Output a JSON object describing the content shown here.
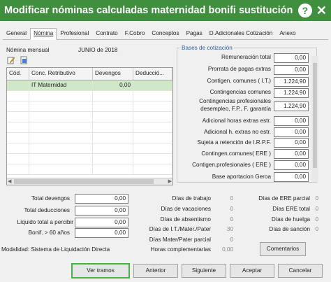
{
  "window": {
    "title": "Modificar nóminas calculadas maternidad bonifi sustitución"
  },
  "tabs": [
    "General",
    "Nómina",
    "Profesional",
    "Contrato",
    "F.Cobro",
    "Conceptos",
    "Pagas",
    "D.Adicionales Cotización",
    "Anexo"
  ],
  "nomina": {
    "label": "Nómina mensual",
    "period": "JUNIO de 2018"
  },
  "grid": {
    "headers": [
      "Cód.",
      "Conc. Retributivo",
      "Devengos",
      "Deducció..."
    ],
    "rows": [
      {
        "cod": "",
        "concepto": "IT Maternidad",
        "devengos": "0,00",
        "deducciones": ""
      }
    ]
  },
  "bases": {
    "title": "Bases de cotización",
    "fields": [
      {
        "label": "Remuneración total",
        "value": "0,00"
      },
      {
        "label": "Prorrata de pagas extras",
        "value": "0,00"
      },
      {
        "label": "Contigen. comunes ( I.T.)",
        "value": "1.224,90"
      },
      {
        "label": "Contingencias comunes",
        "value": "1.224,90"
      },
      {
        "label": "Contingencias profesionales",
        "label2": "desempleo, F.P., F. garantía",
        "value": "1.224,90"
      },
      {
        "label": "Adicional horas extras estr.",
        "value": "0,00"
      },
      {
        "label": "Adicional h. extras no estr.",
        "value": "0,00"
      },
      {
        "label": "Sujeta a retención de I.R.P.F.",
        "value": "0,00"
      },
      {
        "label": "Contingen.comunes( ERE )",
        "value": "0,00"
      },
      {
        "label": "Contigen.profesionales ( ERE )",
        "value": "0,00"
      },
      {
        "label": "Base aportacion Geroa",
        "value": "0,00"
      }
    ]
  },
  "totals": [
    {
      "label": "Total devengos",
      "value": "0,00"
    },
    {
      "label": "Total deducciones",
      "value": "0,00"
    },
    {
      "label": "Líquido total a percibir",
      "value": "0,00"
    },
    {
      "label": "Bonif. > 60 años",
      "value": "0,00"
    }
  ],
  "days_mid": [
    {
      "label": "Días de trabajo",
      "value": "0"
    },
    {
      "label": "Días de vacaciones",
      "value": "0"
    },
    {
      "label": "Días de absentismo",
      "value": "0"
    },
    {
      "label": "Días de I.T./Mater./Pater",
      "value": "30"
    },
    {
      "label": "Días Mater/Pater parcial",
      "value": "0"
    }
  ],
  "days_right": [
    {
      "label": "Días de ERE parcial",
      "value": "0"
    },
    {
      "label": "Días ERE total",
      "value": "0"
    },
    {
      "label": "Días de huelga",
      "value": "0"
    },
    {
      "label": "Días de sanción",
      "value": "0"
    }
  ],
  "horas": {
    "label": "Horas complementarias",
    "value": "0,00"
  },
  "modalidad": "Modalidad: Sistema de Liquidación Directa",
  "buttons": {
    "comentarios": "Comentarios",
    "ver_tramos": "Ver tramos",
    "anterior": "Anterior",
    "siguiente": "Siguiente",
    "aceptar": "Aceptar",
    "cancelar": "Cancelar"
  },
  "colors": {
    "titlebar": "#3f8f3f",
    "selected_row": "#cfe8c8",
    "highlight_border": "#49b049"
  },
  "icons": [
    "edit-icon",
    "document-icon",
    "help-icon",
    "close-icon"
  ]
}
